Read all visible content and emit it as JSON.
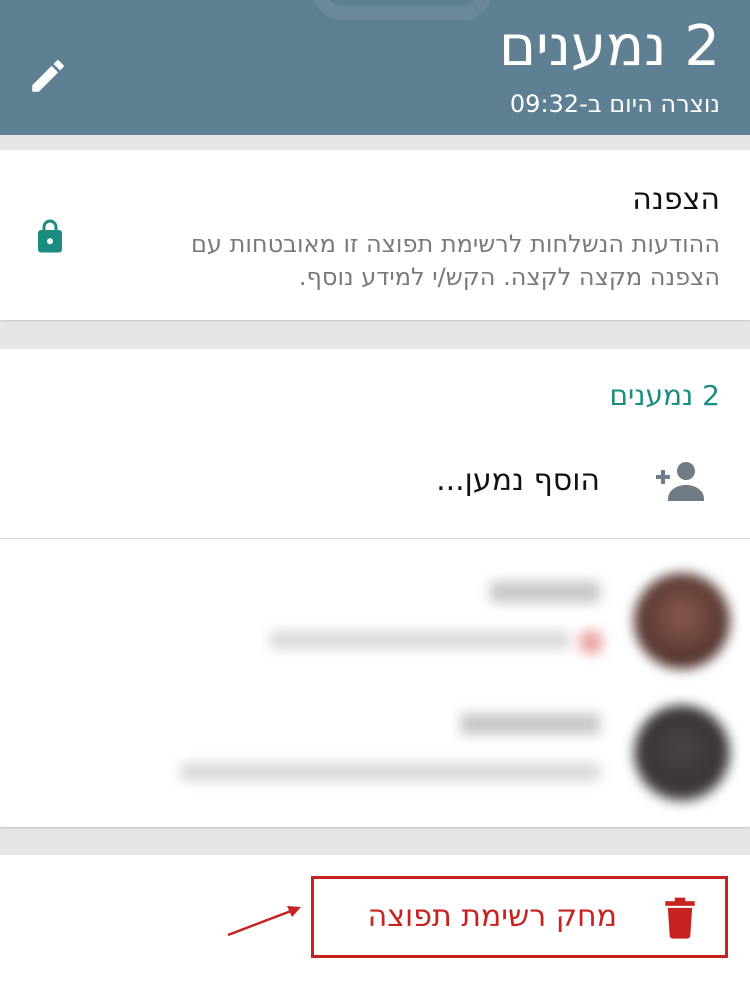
{
  "header": {
    "title": "2 נמענים",
    "subtitle": "נוצרה היום ב-09:32",
    "edit_icon": "pencil-icon"
  },
  "encryption": {
    "title": "הצפנה",
    "description": "ההודעות הנשלחות לרשימת תפוצה זו מאובטחות עם הצפנה מקצה לקצה. הקש/י למידע נוסף.",
    "icon": "lock-icon"
  },
  "participants": {
    "heading": "2 נמענים",
    "add_label": "הוסף נמען...",
    "add_icon": "add-person-icon"
  },
  "delete": {
    "label": "מחק רשימת תפוצה",
    "icon": "trash-icon"
  },
  "colors": {
    "header": "#5f7f92",
    "accent": "#1a8c80",
    "danger": "#c6221f"
  }
}
